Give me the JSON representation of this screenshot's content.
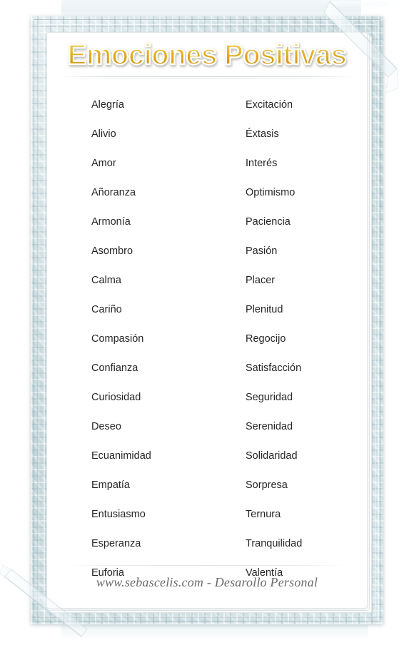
{
  "document": {
    "title": "Emociones Positivas",
    "footer": "www.sebascelis.com - Desarollo Personal"
  },
  "colors": {
    "title_gold_light": "#f6cf55",
    "title_gold_dark": "#cf9310",
    "frame_blue_gray": "#cfdde1",
    "body_text": "#262626",
    "footer_text": "#6b6b6b",
    "card_background": "#ffffff"
  },
  "list": {
    "column_left": [
      "Alegría",
      "Alivio",
      "Amor",
      "Añoranza",
      "Armonía",
      "Asombro",
      "Calma",
      "Cariño",
      "Compasión",
      "Confianza",
      "Curiosidad",
      "Deseo",
      "Ecuanimidad",
      "Empatía",
      "Entusiasmo",
      "Esperanza",
      "Euforia"
    ],
    "column_right": [
      "Excitación",
      "Éxtasis",
      "Interés",
      "Optimismo",
      "Paciencia",
      "Pasión",
      "Placer",
      "Plenitud",
      "Regocijo",
      "Satisfacción",
      "Seguridad",
      "Serenidad",
      "Solidaridad",
      "Sorpresa",
      "Ternura",
      "Tranquilidad",
      "Valentía"
    ]
  },
  "decorations": {
    "peel_top_right": "peeling-corner-icon",
    "peel_bottom_left": "peeling-corner-icon"
  }
}
